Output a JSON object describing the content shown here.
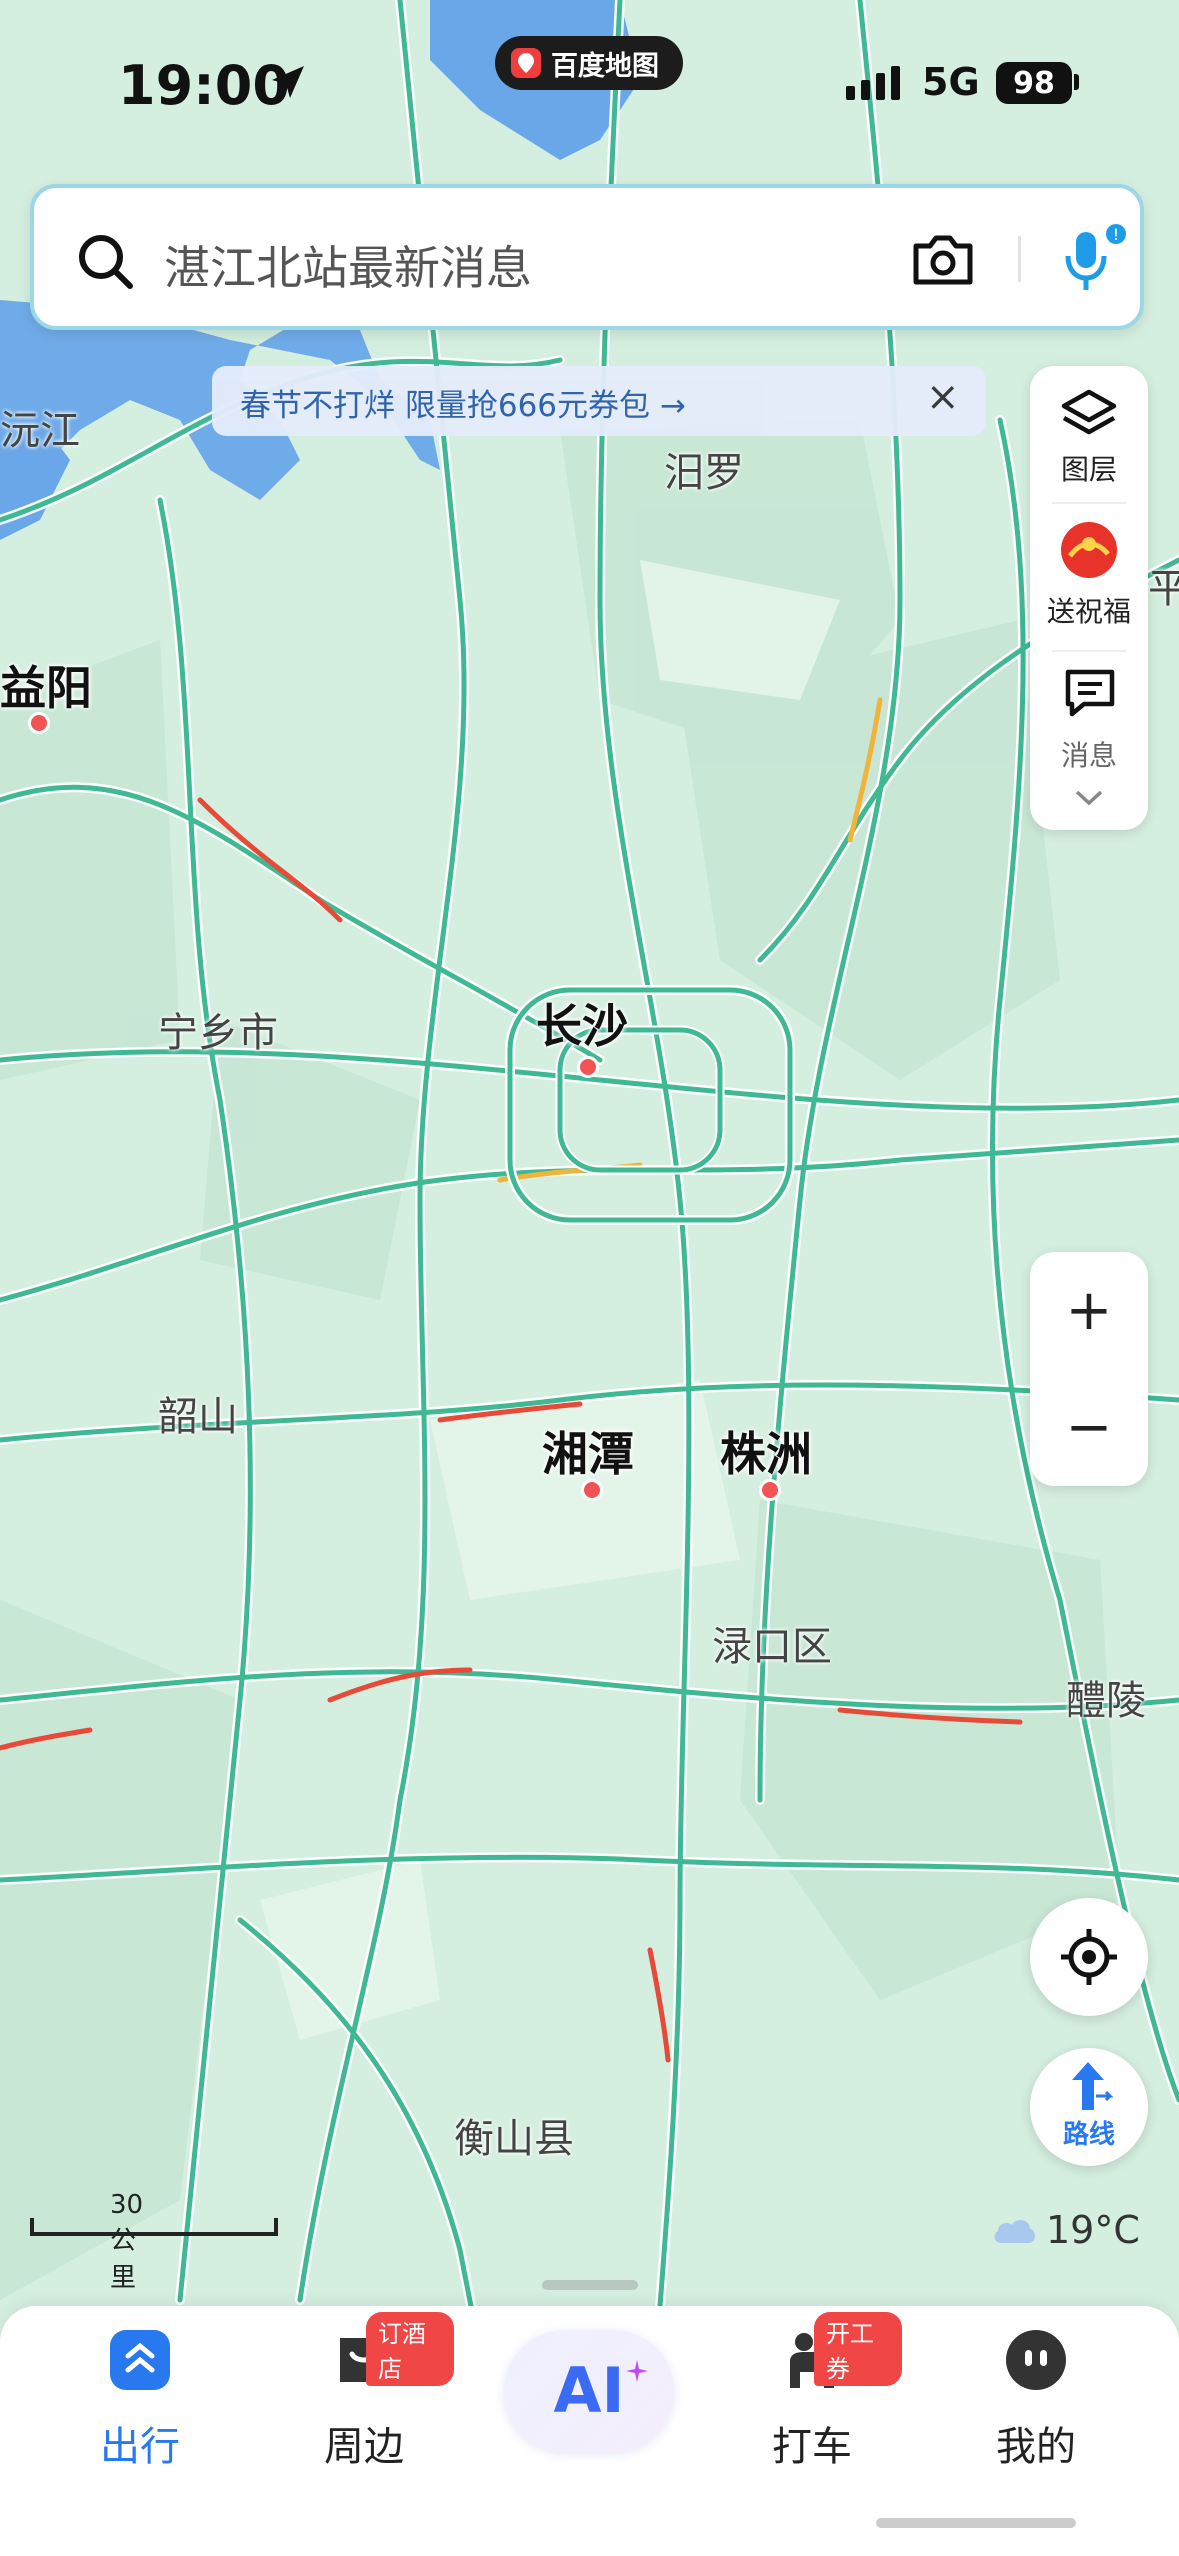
{
  "status_bar": {
    "time": "19:00",
    "app_badge": "百度地图",
    "network": "5G",
    "battery": "98"
  },
  "search": {
    "placeholder": "湛江北站最新消息"
  },
  "promo": {
    "text": "春节不打烊 限量抢666元券包 →",
    "close": "×"
  },
  "side_panel": {
    "layers": "图层",
    "blessing": "送祝福",
    "messages": "消息"
  },
  "zoom": {
    "in": "+",
    "out": "−"
  },
  "route": {
    "label": "路线"
  },
  "map": {
    "cities": [
      {
        "key": "changsha",
        "name": "长沙"
      },
      {
        "key": "xiangtan",
        "name": "湘潭"
      },
      {
        "key": "zhuzhou",
        "name": "株洲"
      },
      {
        "key": "yiyang",
        "name": "益阳"
      }
    ],
    "towns": [
      "沅江",
      "汨罗",
      "宁乡市",
      "韶山",
      "渌口区",
      "醴陵",
      "衡山县",
      "平江"
    ]
  },
  "scale": {
    "label": "30 公里"
  },
  "weather": {
    "temp": "19°C"
  },
  "tabbar": {
    "tabs": [
      {
        "label": "出行",
        "active": true
      },
      {
        "label": "周边",
        "badge": "订酒店"
      },
      {
        "label": "AI"
      },
      {
        "label": "打车",
        "badge": "开工券"
      },
      {
        "label": "我的"
      }
    ]
  },
  "colors": {
    "accent": "#2878f0",
    "badge": "#f04646",
    "land": "#d6efe0",
    "road": "#3fb894"
  }
}
